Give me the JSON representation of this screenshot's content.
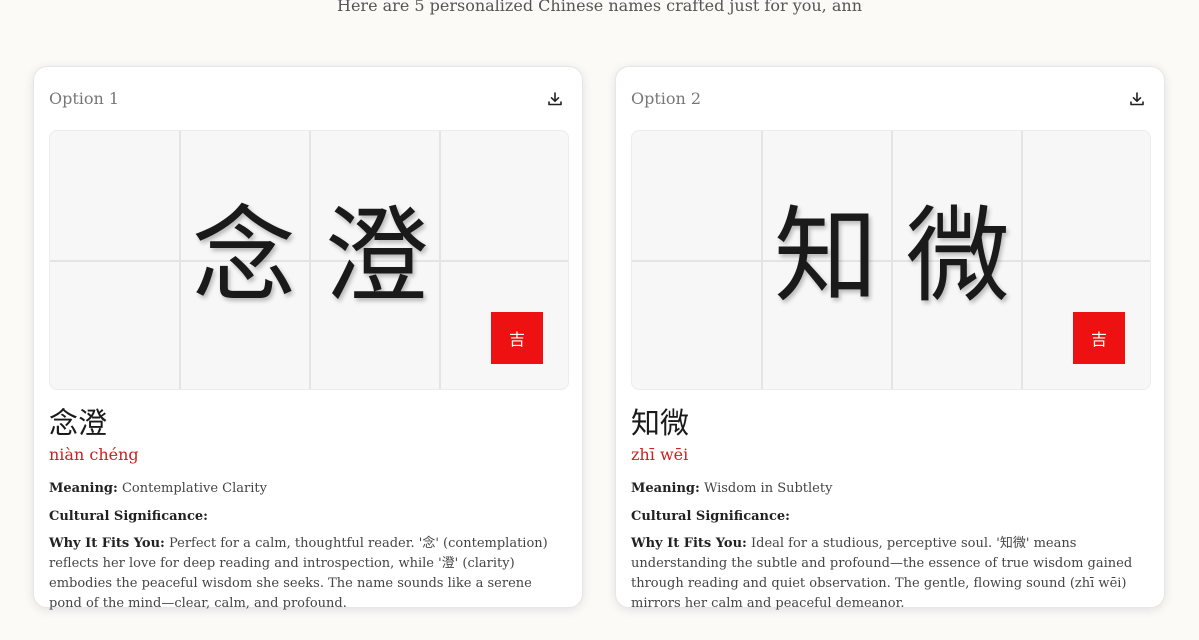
{
  "header": {
    "subtitle": "Here are 5 personalized Chinese names crafted just for you, ann"
  },
  "labels": {
    "meaning": "Meaning:",
    "cultural": "Cultural Significance:",
    "why": "Why It Fits You:"
  },
  "icons": {
    "download": "download-icon"
  },
  "colors": {
    "seal": "#ee1111",
    "pinyin": "#cc1f1f"
  },
  "cards": [
    {
      "option_label": "Option 1",
      "char1": "念",
      "char2": "澄",
      "seal_text": "吉",
      "name_cn": "念澄",
      "pinyin": "niàn chéng",
      "meaning": "Contemplative Clarity",
      "cultural": "",
      "why": "Perfect for a calm, thoughtful reader. '念' (contemplation) reflects her love for deep reading and introspection, while '澄' (clarity) embodies the peaceful wisdom she seeks. The name sounds like a serene pond of the mind—clear, calm, and profound."
    },
    {
      "option_label": "Option 2",
      "char1": "知",
      "char2": "微",
      "seal_text": "吉",
      "name_cn": "知微",
      "pinyin": "zhī wēi",
      "meaning": "Wisdom in Subtlety",
      "cultural": "",
      "why": "Ideal for a studious, perceptive soul. '知微' means understanding the subtle and profound—the essence of true wisdom gained through reading and quiet observation. The gentle, flowing sound (zhī wēi) mirrors her calm and peaceful demeanor."
    }
  ]
}
